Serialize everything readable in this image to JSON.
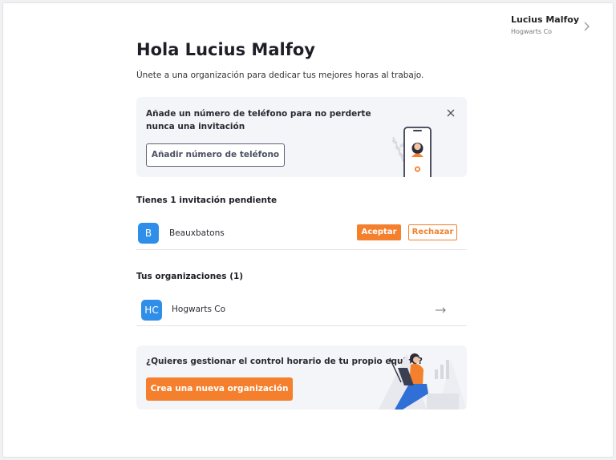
{
  "user": {
    "name": "Lucius Malfoy",
    "organization": "Hogwarts Co"
  },
  "header": {
    "title": "Hola Lucius Malfoy",
    "subtitle": "Únete a una organización para dedicar tus mejores horas al trabajo."
  },
  "phone_banner": {
    "message": "Añade un número de teléfono para no perderte nunca una invitación",
    "button_label": "Añadir número de teléfono",
    "close_icon": "close-icon"
  },
  "invitations": {
    "heading": "Tienes 1 invitación pendiente",
    "items": [
      {
        "initial": "B",
        "name": "Beauxbatons",
        "accept_label": "Aceptar",
        "reject_label": "Rechazar"
      }
    ]
  },
  "organizations": {
    "heading": "Tus organizaciones (1)",
    "items": [
      {
        "initials": "HC",
        "name": "Hogwarts Co"
      }
    ]
  },
  "create_banner": {
    "message": "¿Quieres gestionar el control horario de tu propio equipo?",
    "button_label": "Crea una nueva organización"
  },
  "colors": {
    "accent": "#f47f2c",
    "avatar": "#2f8fe8",
    "card_background": "#f4f5f8"
  }
}
